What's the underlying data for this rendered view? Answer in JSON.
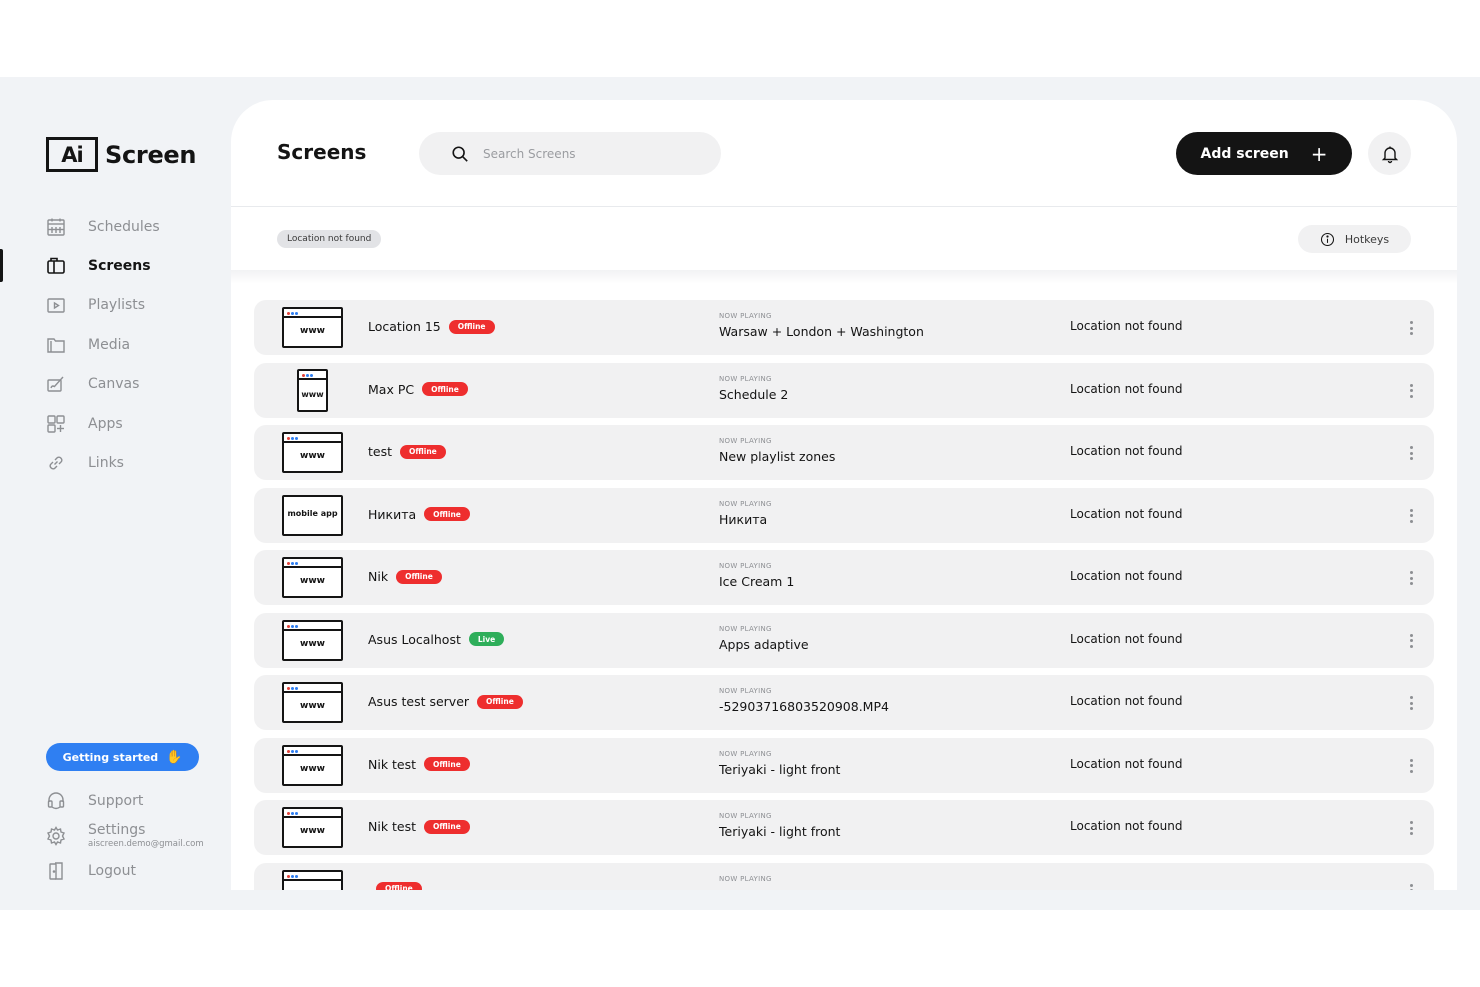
{
  "app": {
    "logo_mark": "Ai",
    "logo_text": "Screen"
  },
  "sidebar": {
    "items": [
      {
        "label": "Schedules",
        "icon": "calendar-icon"
      },
      {
        "label": "Screens",
        "icon": "screens-icon",
        "active": true
      },
      {
        "label": "Playlists",
        "icon": "playlist-icon"
      },
      {
        "label": "Media",
        "icon": "folder-icon"
      },
      {
        "label": "Canvas",
        "icon": "canvas-icon"
      },
      {
        "label": "Apps",
        "icon": "apps-icon"
      },
      {
        "label": "Links",
        "icon": "link-icon"
      }
    ],
    "getting_started": "Getting started",
    "support": "Support",
    "settings": "Settings",
    "settings_email": "aiscreen.demo@gmail.com",
    "logout": "Logout"
  },
  "header": {
    "title": "Screens",
    "search_placeholder": "Search Screens",
    "add_label": "Add screen",
    "add_icon": "+"
  },
  "filters": {
    "chip": "Location not found",
    "hotkeys": "Hotkeys"
  },
  "list": {
    "now_playing_label": "NOW PLAYING",
    "rows": [
      {
        "thumb": "www",
        "kind": "wide",
        "name": "Location 15",
        "status": "Offline",
        "now_playing": "Warsaw + London + Washington",
        "location": "Location not found"
      },
      {
        "thumb": "www",
        "kind": "tall",
        "name": "Max PC",
        "status": "Offline",
        "now_playing": "Schedule 2",
        "location": "Location not found"
      },
      {
        "thumb": "www",
        "kind": "wide",
        "name": "test",
        "status": "Offline",
        "now_playing": "New playlist zones",
        "location": "Location not found"
      },
      {
        "thumb": "mobile app",
        "kind": "mobile",
        "name": "Никита",
        "status": "Offline",
        "now_playing": "Никита",
        "location": "Location not found"
      },
      {
        "thumb": "www",
        "kind": "wide",
        "name": "Nik",
        "status": "Offline",
        "now_playing": "Ice Cream 1",
        "location": "Location not found"
      },
      {
        "thumb": "www",
        "kind": "wide",
        "name": "Asus Localhost",
        "status": "Live",
        "now_playing": "Apps adaptive",
        "location": "Location not found"
      },
      {
        "thumb": "www",
        "kind": "wide",
        "name": "Asus test server",
        "status": "Offline",
        "now_playing": "-52903716803520908.MP4",
        "location": "Location not found"
      },
      {
        "thumb": "www",
        "kind": "wide",
        "name": "Nik test",
        "status": "Offline",
        "now_playing": "Teriyaki - light front",
        "location": "Location not found"
      },
      {
        "thumb": "www",
        "kind": "wide",
        "name": "Nik test",
        "status": "Offline",
        "now_playing": "Teriyaki - light front",
        "location": "Location not found"
      },
      {
        "thumb": "",
        "kind": "partial",
        "name": "",
        "status": "Offline",
        "now_playing": "",
        "location": ""
      }
    ]
  },
  "colors": {
    "accent": "#2f7ff2",
    "offline": "#ee2e2e",
    "live": "#2eae5a",
    "dark": "#141414"
  }
}
